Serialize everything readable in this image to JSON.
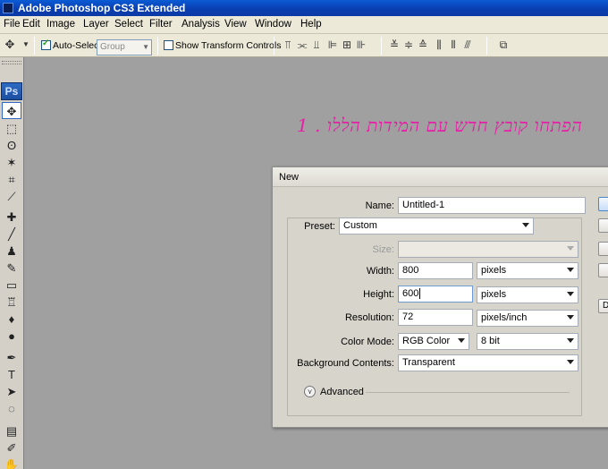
{
  "window": {
    "title": "Adobe Photoshop CS3 Extended"
  },
  "menu": [
    "File",
    "Edit",
    "Image",
    "Layer",
    "Select",
    "Filter",
    "Analysis",
    "View",
    "Window",
    "Help"
  ],
  "options": {
    "auto_select_label": "Auto-Select:",
    "auto_select_checked": true,
    "auto_select_value": "Group",
    "show_transform_label": "Show Transform Controls",
    "show_transform_checked": false
  },
  "toolbox": {
    "logo": "Ps",
    "tools": [
      "move-tool",
      "marquee-tool",
      "lasso-tool",
      "magic-wand-tool",
      "crop-tool",
      "slice-tool",
      "healing-brush-tool",
      "brush-tool",
      "clone-stamp-tool",
      "history-brush-tool",
      "eraser-tool",
      "paint-bucket-tool",
      "blur-tool",
      "dodge-tool",
      "pen-tool",
      "type-tool",
      "path-selection-tool",
      "shape-tool",
      "notes-tool",
      "eyedropper-tool",
      "hand-tool"
    ],
    "glyphs": [
      "✥",
      "⬚",
      "ʘ",
      "✶",
      "⌗",
      "⟋",
      "✚",
      "╱",
      "♟",
      "✎",
      "▭",
      "♖",
      "♦",
      "●",
      "✒",
      "T",
      "➤",
      "◌",
      "▤",
      "✐",
      "✋"
    ]
  },
  "canvas_text": "1 . הפתחו קובץ חדש עם המידות הללו",
  "dialog": {
    "title": "New",
    "name_label": "Name:",
    "name_value": "Untitled-1",
    "preset_label": "Preset:",
    "preset_value": "Custom",
    "size_label": "Size:",
    "size_value": "",
    "width_label": "Width:",
    "width_value": "800",
    "width_unit": "pixels",
    "height_label": "Height:",
    "height_value": "600",
    "height_unit": "pixels",
    "resolution_label": "Resolution:",
    "resolution_value": "72",
    "resolution_unit": "pixels/inch",
    "color_mode_label": "Color Mode:",
    "color_mode_value": "RGB Color",
    "bit_depth_value": "8 bit",
    "background_label": "Background Contents:",
    "background_value": "Transparent",
    "advanced_label": "Advanced",
    "side_button_5": "D"
  },
  "colors": {
    "accent": "#0a3fb0",
    "canvas_text": "#e61fa7",
    "workspace": "#a0a0a0"
  }
}
